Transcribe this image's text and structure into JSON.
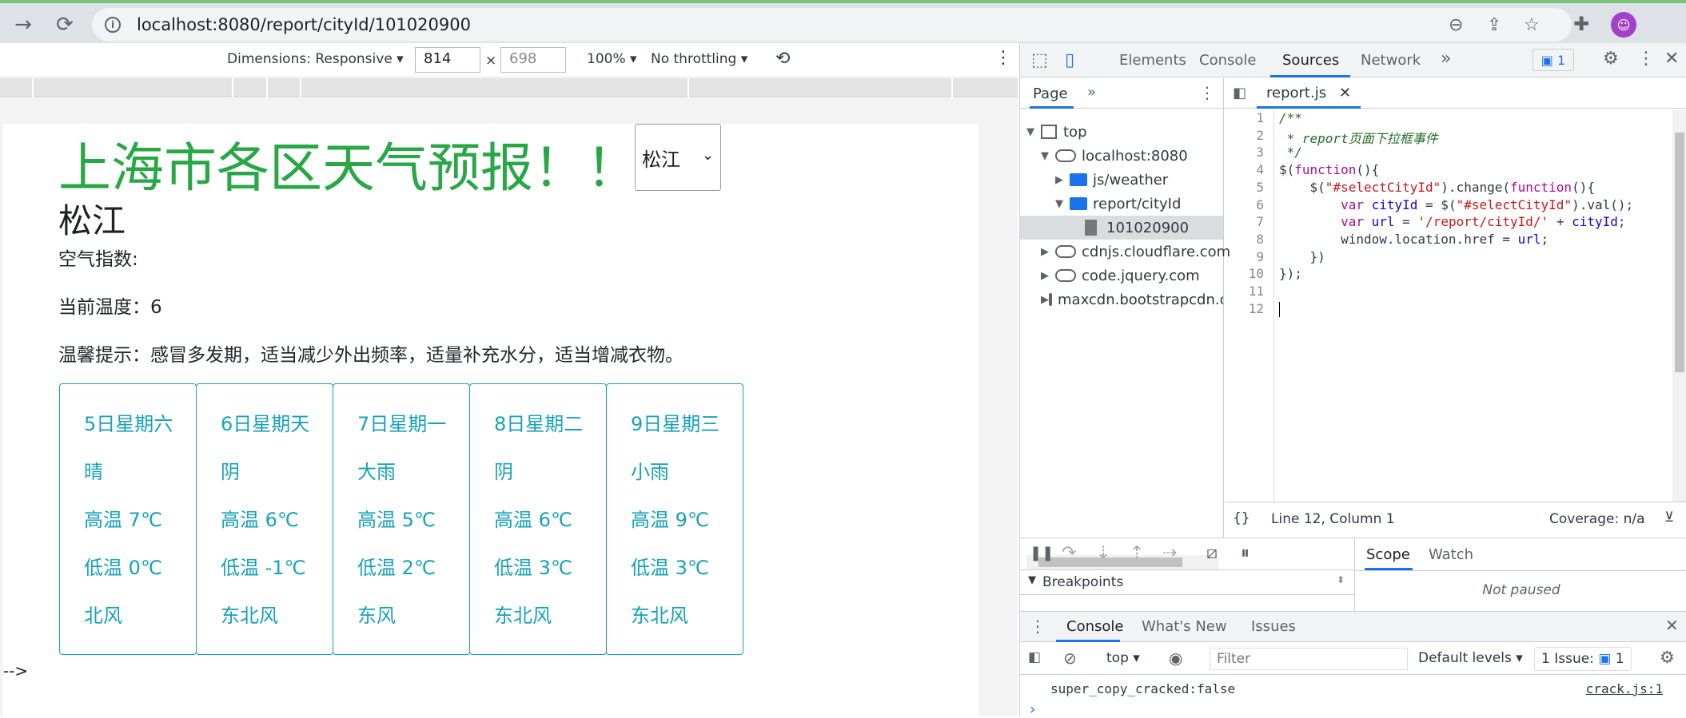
{
  "browser": {
    "url": "localhost:8080/report/cityId/101020900",
    "icons": [
      "forward-icon",
      "reload-icon",
      "info-icon",
      "zoom-icon",
      "share-icon",
      "star-icon",
      "extensions-icon",
      "profile-avatar"
    ]
  },
  "device_toolbar": {
    "dimensions_label": "Dimensions: Responsive",
    "width": "814",
    "x_sep": "×",
    "height": "698",
    "zoom": "100%",
    "throttling": "No throttling"
  },
  "page": {
    "heading": "上海市各区天气预报！！！",
    "select_value": "松江",
    "city_name": "松江",
    "aqi_label": "空气指数:",
    "temp_label": "当前温度：6",
    "tip_label": "温馨提示：感冒多发期，适当减少外出频率，适量补充水分，适当增减衣物。",
    "forecast": [
      {
        "date": "5日星期六",
        "weather": "晴",
        "high": "高温 7℃",
        "low": "低温 0℃",
        "wind": "北风"
      },
      {
        "date": "6日星期天",
        "weather": "阴",
        "high": "高温 6℃",
        "low": "低温 -1℃",
        "wind": "东北风"
      },
      {
        "date": "7日星期一",
        "weather": "大雨",
        "high": "高温 5℃",
        "low": "低温 2℃",
        "wind": "东风"
      },
      {
        "date": "8日星期二",
        "weather": "阴",
        "high": "高温 6℃",
        "low": "低温 3℃",
        "wind": "东北风"
      },
      {
        "date": "9日星期三",
        "weather": "小雨",
        "high": "高温 9℃",
        "low": "低温 3℃",
        "wind": "东北风"
      }
    ],
    "trailing_text": "-->"
  },
  "devtools": {
    "tabs": [
      "Elements",
      "Console",
      "Sources",
      "Network"
    ],
    "more": "»",
    "issues_count": "1",
    "navigator": {
      "tab": "Page",
      "tree": [
        "top",
        "localhost:8080",
        "js/weather",
        "report/cityId",
        "101020900",
        "cdnjs.cloudflare.com",
        "code.jquery.com",
        "maxcdn.bootstrapcdn.c"
      ]
    },
    "editor": {
      "file_tab": "report.js",
      "lines": [
        "/**",
        " * report页面下拉框事件",
        " */",
        "$(function(){",
        "    $(\"#selectCityId\").change(function(){",
        "        var cityId = $(\"#selectCityId\").val();",
        "        var url = '/report/cityId/' + cityId;",
        "        window.location.href = url;",
        "    })",
        "});",
        "",
        ""
      ],
      "line_numbers": [
        "1",
        "2",
        "3",
        "4",
        "5",
        "6",
        "7",
        "8",
        "9",
        "10",
        "11",
        "12"
      ],
      "status_position": "Line 12, Column 1",
      "coverage": "Coverage: n/a",
      "braces": "{}"
    },
    "debugger": {
      "breakpoints": "Breakpoints",
      "scope_tab": "Scope",
      "watch_tab": "Watch",
      "not_paused": "Not paused"
    },
    "console": {
      "tabs": [
        "Console",
        "What's New",
        "Issues"
      ],
      "context": "top",
      "filter_placeholder": "Filter",
      "levels": "Default levels",
      "issue_label": "1 Issue:",
      "issue_count": "1",
      "message": "super_copy_cracked:false",
      "source": "crack.js:1",
      "prompt": "›"
    }
  },
  "colors": {
    "heading_green": "#28a745",
    "card_teal": "#17a2b8",
    "devtools_blue": "#1a73e8"
  }
}
